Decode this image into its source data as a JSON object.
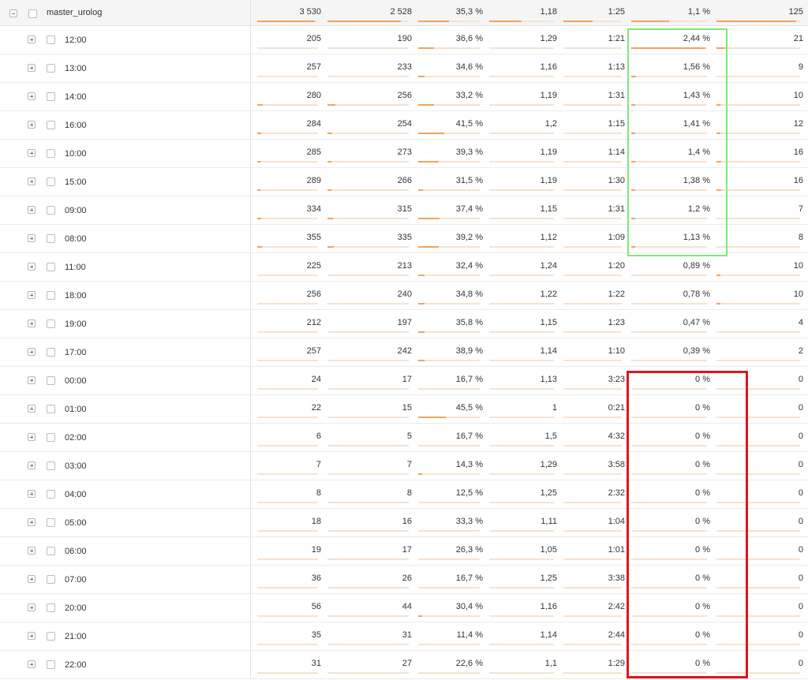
{
  "report": {
    "total": {
      "label": "master_urolog",
      "values": [
        "3 530",
        "2 528",
        "35,3 %",
        "1,18",
        "1:25",
        "1,1 %",
        "125"
      ],
      "fills": [
        0.95,
        0.9,
        0.5,
        0.5,
        0.5,
        0.5,
        0.95
      ]
    },
    "rows": [
      {
        "label": "12:00",
        "values": [
          "205",
          "190",
          "36,6 %",
          "1,29",
          "1:21",
          "2,44 %",
          "21"
        ],
        "fills": [
          0.0,
          0.0,
          0.25,
          0.0,
          0.0,
          0.98,
          0.1
        ]
      },
      {
        "label": "13:00",
        "values": [
          "257",
          "233",
          "34,6 %",
          "1,16",
          "1:13",
          "1,56 %",
          "9"
        ],
        "fills": [
          0.0,
          0.0,
          0.1,
          0.0,
          0.0,
          0.06,
          0.0
        ]
      },
      {
        "label": "14:00",
        "values": [
          "280",
          "256",
          "33,2 %",
          "1,19",
          "1:31",
          "1,43 %",
          "10"
        ],
        "fills": [
          0.09,
          0.1,
          0.25,
          0.0,
          0.0,
          0.05,
          0.05
        ]
      },
      {
        "label": "16:00",
        "values": [
          "284",
          "254",
          "41,5 %",
          "1,2",
          "1:15",
          "1,41 %",
          "12"
        ],
        "fills": [
          0.06,
          0.06,
          0.42,
          0.0,
          0.0,
          0.05,
          0.05
        ]
      },
      {
        "label": "10:00",
        "values": [
          "285",
          "273",
          "39,3 %",
          "1,19",
          "1:14",
          "1,4 %",
          "16"
        ],
        "fills": [
          0.05,
          0.05,
          0.33,
          0.0,
          0.0,
          0.05,
          0.06
        ]
      },
      {
        "label": "15:00",
        "values": [
          "289",
          "266",
          "31,5 %",
          "1,19",
          "1:30",
          "1,38 %",
          "16"
        ],
        "fills": [
          0.05,
          0.05,
          0.08,
          0.0,
          0.0,
          0.05,
          0.06
        ]
      },
      {
        "label": "09:00",
        "values": [
          "334",
          "315",
          "37,4 %",
          "1,15",
          "1:31",
          "1,2 %",
          "7"
        ],
        "fills": [
          0.07,
          0.07,
          0.35,
          0.0,
          0.0,
          0.05,
          0.0
        ]
      },
      {
        "label": "08:00",
        "values": [
          "355",
          "335",
          "39,2 %",
          "1,12",
          "1:09",
          "1,13 %",
          "8"
        ],
        "fills": [
          0.08,
          0.08,
          0.33,
          0.0,
          0.0,
          0.05,
          0.0
        ]
      },
      {
        "label": "11:00",
        "values": [
          "225",
          "213",
          "32,4 %",
          "1,24",
          "1:20",
          "0,89 %",
          "10"
        ],
        "fills": [
          0.0,
          0.0,
          0.1,
          0.0,
          0.0,
          0.0,
          0.05
        ]
      },
      {
        "label": "18:00",
        "values": [
          "256",
          "240",
          "34,8 %",
          "1,22",
          "1:22",
          "0,78 %",
          "10"
        ],
        "fills": [
          0.0,
          0.0,
          0.1,
          0.0,
          0.0,
          0.0,
          0.05
        ]
      },
      {
        "label": "19:00",
        "values": [
          "212",
          "197",
          "35,8 %",
          "1,15",
          "1:23",
          "0,47 %",
          "4"
        ],
        "fills": [
          0.0,
          0.0,
          0.1,
          0.0,
          0.0,
          0.0,
          0.0
        ]
      },
      {
        "label": "17:00",
        "values": [
          "257",
          "242",
          "38,9 %",
          "1,14",
          "1:10",
          "0,39 %",
          "2"
        ],
        "fills": [
          0.0,
          0.0,
          0.1,
          0.0,
          0.0,
          0.0,
          0.0
        ]
      },
      {
        "label": "00:00",
        "values": [
          "24",
          "17",
          "16,7 %",
          "1,13",
          "3:23",
          "0 %",
          "0"
        ],
        "fills": [
          0.0,
          0.0,
          0.0,
          0.0,
          0.0,
          0.0,
          0.0
        ]
      },
      {
        "label": "01:00",
        "values": [
          "22",
          "15",
          "45,5 %",
          "1",
          "0:21",
          "0 %",
          "0"
        ],
        "fills": [
          0.0,
          0.0,
          0.45,
          0.0,
          0.0,
          0.0,
          0.0
        ]
      },
      {
        "label": "02:00",
        "values": [
          "6",
          "5",
          "16,7 %",
          "1,5",
          "4:32",
          "0 %",
          "0"
        ],
        "fills": [
          0.0,
          0.0,
          0.0,
          0.0,
          0.0,
          0.0,
          0.0
        ]
      },
      {
        "label": "03:00",
        "values": [
          "7",
          "7",
          "14,3 %",
          "1,29",
          "3:58",
          "0 %",
          "0"
        ],
        "fills": [
          0.0,
          0.0,
          0.06,
          0.0,
          0.0,
          0.0,
          0.0
        ]
      },
      {
        "label": "04:00",
        "values": [
          "8",
          "8",
          "12,5 %",
          "1,25",
          "2:32",
          "0 %",
          "0"
        ],
        "fills": [
          0.0,
          0.0,
          0.0,
          0.0,
          0.0,
          0.0,
          0.0
        ]
      },
      {
        "label": "05:00",
        "values": [
          "18",
          "16",
          "33,3 %",
          "1,11",
          "1:04",
          "0 %",
          "0"
        ],
        "fills": [
          0.0,
          0.0,
          0.0,
          0.0,
          0.0,
          0.0,
          0.0
        ]
      },
      {
        "label": "06:00",
        "values": [
          "19",
          "17",
          "26,3 %",
          "1,05",
          "1:01",
          "0 %",
          "0"
        ],
        "fills": [
          0.0,
          0.0,
          0.0,
          0.0,
          0.0,
          0.0,
          0.0
        ]
      },
      {
        "label": "07:00",
        "values": [
          "36",
          "26",
          "16,7 %",
          "1,25",
          "3:38",
          "0 %",
          "0"
        ],
        "fills": [
          0.0,
          0.0,
          0.0,
          0.0,
          0.0,
          0.0,
          0.0
        ]
      },
      {
        "label": "20:00",
        "values": [
          "56",
          "44",
          "30,4 %",
          "1,16",
          "2:42",
          "0 %",
          "0"
        ],
        "fills": [
          0.0,
          0.0,
          0.06,
          0.0,
          0.0,
          0.0,
          0.0
        ]
      },
      {
        "label": "21:00",
        "values": [
          "35",
          "31",
          "11,4 %",
          "1,14",
          "2:44",
          "0 %",
          "0"
        ],
        "fills": [
          0.0,
          0.0,
          0.0,
          0.0,
          0.0,
          0.0,
          0.0
        ]
      },
      {
        "label": "22:00",
        "values": [
          "31",
          "27",
          "22,6 %",
          "1,1",
          "1:29",
          "0 %",
          "0"
        ],
        "fills": [
          0.0,
          0.0,
          0.0,
          0.0,
          0.0,
          0.0,
          0.0
        ]
      }
    ]
  },
  "colors": {
    "bar_fill": "#f2a45e",
    "bar_track": "#f6e3d0",
    "highlight_top": "#7fe87a",
    "highlight_zero": "#e1141c"
  }
}
